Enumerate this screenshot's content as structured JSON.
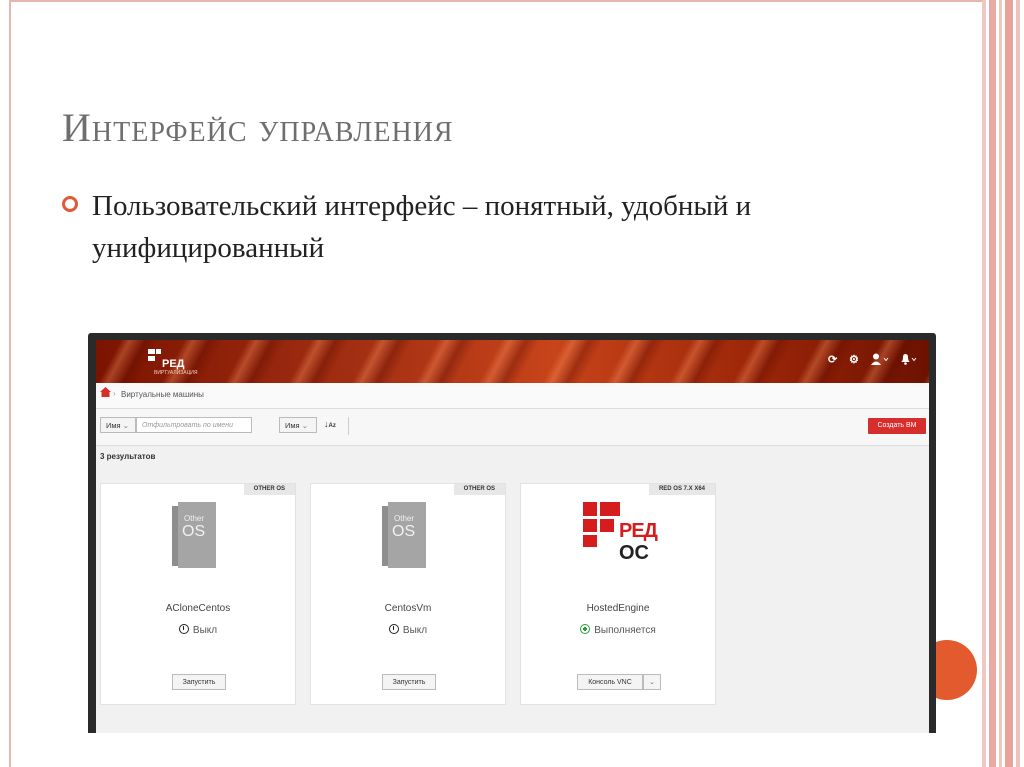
{
  "slide": {
    "title": "Интерфейс управления",
    "bullet": "Пользовательский интерфейс – понятный, удобный и унифицированный"
  },
  "colors": {
    "accent": "#e05a36",
    "frame": "#e8b6b0",
    "topbar": "#a83214",
    "create_button": "#d62d2d",
    "running_status": "#2a9d3a"
  },
  "app": {
    "logo_text": "РЕД",
    "logo_subtext": "ВИРТУАЛИЗАЦИЯ",
    "topbar_icons": [
      "refresh-icon",
      "gear-icon",
      "user-icon",
      "bell-icon"
    ],
    "breadcrumb": [
      "Виртуальные машины"
    ],
    "toolbar": {
      "filter_field_select": "Имя",
      "filter_placeholder": "Отфильтровать по имени",
      "sort_field_select": "Имя",
      "create_button": "Создать ВМ"
    },
    "results_count": "3 результатов",
    "vms": [
      {
        "os_tag": "OTHER OS",
        "icon_line1": "Other",
        "icon_line2": "OS",
        "name": "ACloneCentos",
        "status": "Выкл",
        "action": "Запустить"
      },
      {
        "os_tag": "OTHER OS",
        "icon_line1": "Other",
        "icon_line2": "OS",
        "name": "CentosVm",
        "status": "Выкл",
        "action": "Запустить"
      },
      {
        "os_tag": "RED OS 7.X X64",
        "logo_line1": "РЕД",
        "logo_line2": "ОС",
        "name": "HostedEngine",
        "status": "Выполняется",
        "action": "Консоль VNC"
      }
    ]
  }
}
